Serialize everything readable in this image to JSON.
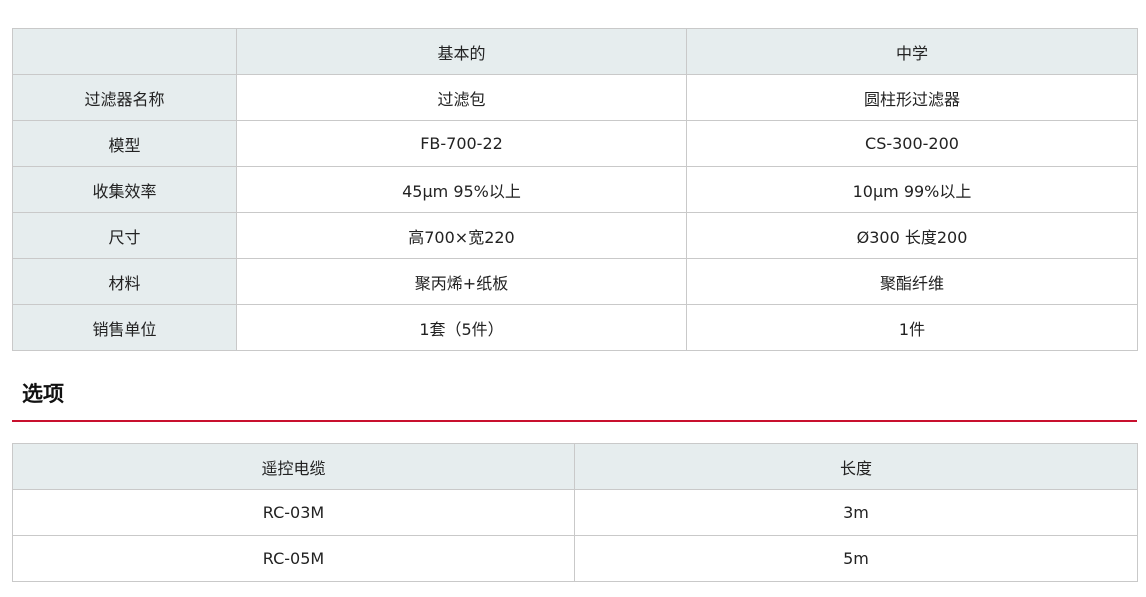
{
  "spec_table": {
    "headers": [
      "",
      "基本的",
      "中学"
    ],
    "rows": [
      {
        "label": "过滤器名称",
        "basic": "过滤包",
        "secondary": "圆柱形过滤器"
      },
      {
        "label": "模型",
        "basic": "FB-700-22",
        "secondary": "CS-300-200"
      },
      {
        "label": "收集效率",
        "basic": "45μm 95%以上",
        "secondary": "10μm 99%以上"
      },
      {
        "label": "尺寸",
        "basic": "高700×宽220",
        "secondary": "Ø300 长度200"
      },
      {
        "label": "材料",
        "basic": "聚丙烯+纸板",
        "secondary": "聚酯纤维"
      },
      {
        "label": "销售单位",
        "basic": "1套（5件）",
        "secondary": "1件"
      }
    ]
  },
  "options": {
    "title": "选项",
    "accent_color": "#c8102e",
    "headers": [
      "遥控电缆",
      "长度"
    ],
    "rows": [
      {
        "cable": "RC-03M",
        "length": "3m"
      },
      {
        "cable": "RC-05M",
        "length": "5m"
      }
    ]
  }
}
